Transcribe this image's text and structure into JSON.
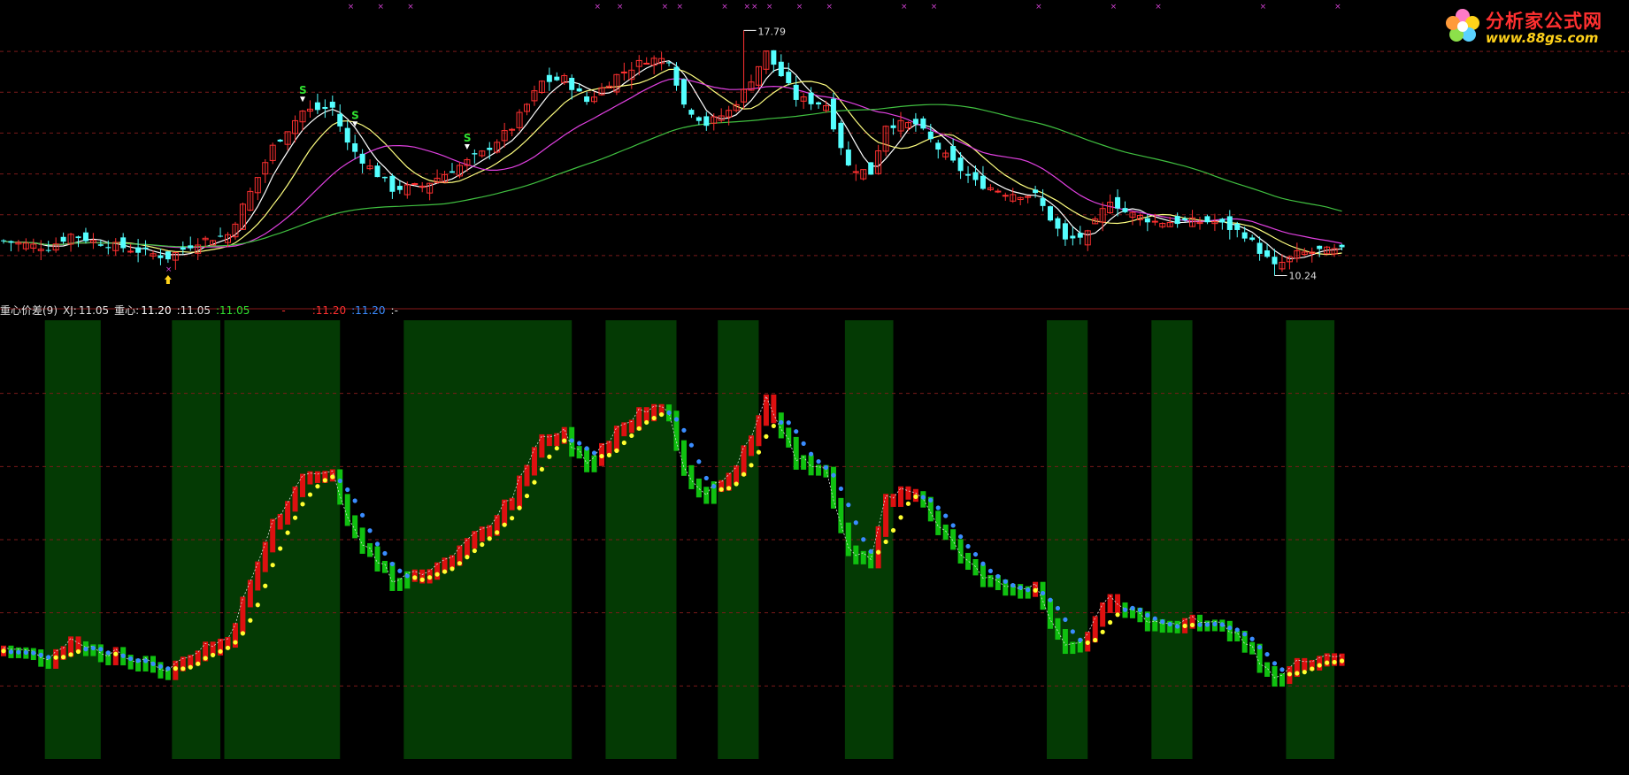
{
  "logo": {
    "title": "分析家公式网",
    "url": "www.88gs.com"
  },
  "colors": {
    "background": "#000000",
    "up": "#ff3030",
    "down": "#54ffff",
    "grid": "#7a1a1a",
    "ma_white": "#ffffff",
    "ma_yellow": "#ffff80",
    "ma_magenta": "#e040e0",
    "ma_green": "#40c040",
    "ind_up": "#dd1010",
    "ind_down": "#10c010",
    "zone": "#043a04",
    "dot_yellow": "#ffff30",
    "dot_blue": "#3a8cff"
  },
  "indicator_header": {
    "name": "重心价差(9)",
    "xj_label": "XJ:",
    "xj_value": "11.05",
    "zx_label": "重心:",
    "zx_value": "11.20",
    "v3": ":11.05",
    "v4": ":11.05",
    "v5": "-",
    "v6": ":11.20",
    "v7": ":11.20",
    "v8": ":-"
  },
  "chart_data": [
    {
      "type": "candlestick",
      "panel": "price",
      "ylim": [
        9.6,
        18.4
      ],
      "annotations": {
        "high_label": "17.79",
        "low_label": "10.24",
        "signal_text": "S"
      },
      "moving_averages": [
        "white",
        "yellow",
        "magenta",
        "green"
      ]
    },
    {
      "type": "bar",
      "panel": "indicator",
      "title": "重心价差(9)",
      "series": [
        {
          "name": "XJ",
          "last": 11.05
        },
        {
          "name": "重心",
          "last": 11.2
        }
      ]
    }
  ]
}
